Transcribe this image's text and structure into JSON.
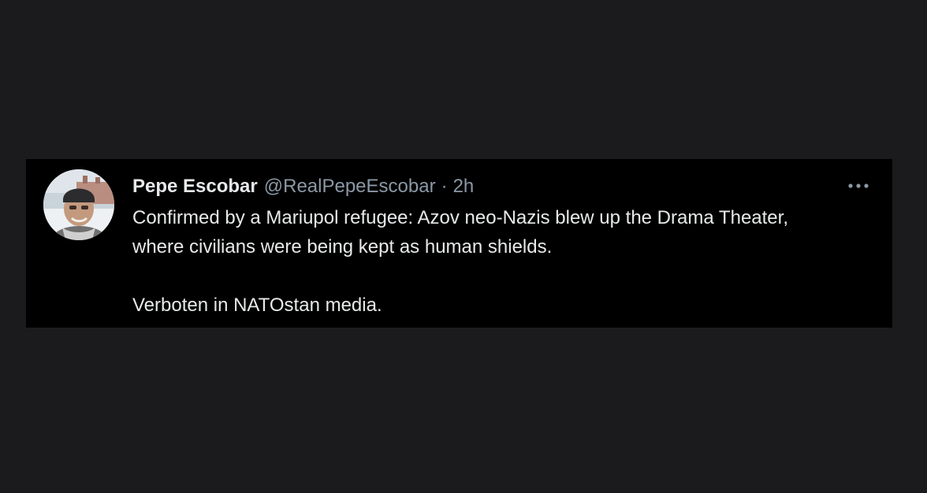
{
  "tweet": {
    "author_name": "Pepe Escobar",
    "author_handle": "@RealPepeEscobar",
    "separator": "·",
    "timestamp": "2h",
    "more_icon": "more-horizontal-icon",
    "paragraphs": [
      "Confirmed by a Mariupol refugee: Azov neo-Nazis blew up the Drama Theater, where civilians were being kept as human shields.",
      "Verboten in NATOstan media."
    ]
  },
  "colors": {
    "page_background": "#1b1b1d",
    "card_background": "#000000",
    "primary_text": "#e7e9ea",
    "secondary_text": "#8b98a5"
  }
}
